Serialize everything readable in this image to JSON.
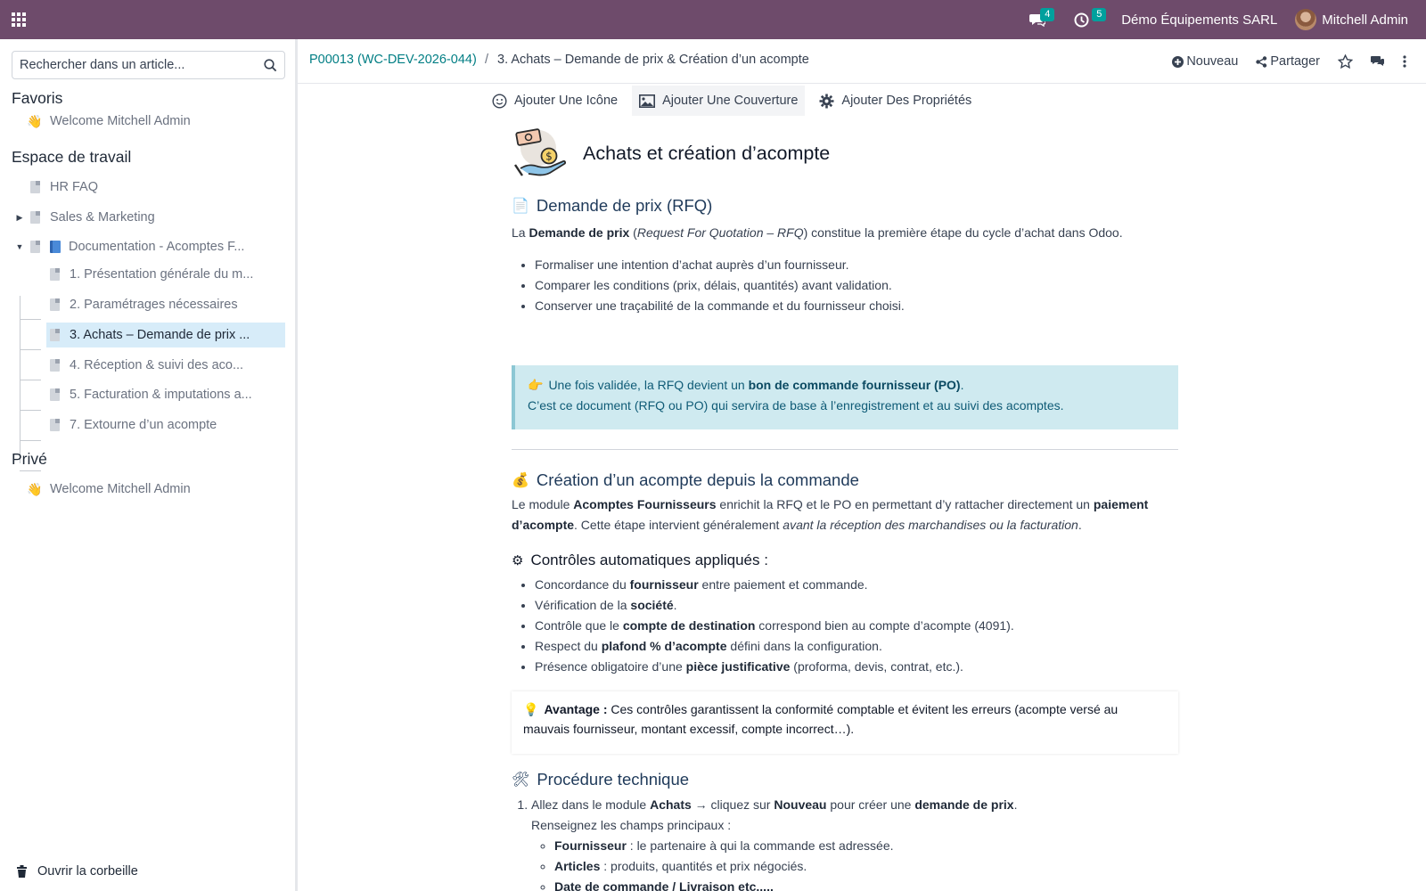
{
  "topbar": {
    "messages_count": "4",
    "activities_count": "5",
    "company": "Démo Équipements SARL",
    "user": "Mitchell Admin"
  },
  "sidebar": {
    "search_placeholder": "Rechercher dans un article...",
    "favorites_title": "Favoris",
    "favorites": [
      {
        "emoji": "👋",
        "label": "Welcome Mitchell Admin"
      }
    ],
    "workspace_title": "Espace de travail",
    "workspace": [
      {
        "label": "HR FAQ"
      },
      {
        "label": "Sales & Marketing"
      },
      {
        "label": "Documentation - Acomptes F..."
      }
    ],
    "children": [
      "1. Présentation générale du m...",
      "2. Paramétrages nécessaires",
      "3. Achats – Demande de prix ...",
      "4. Réception & suivi des aco...",
      "5. Facturation & imputations a...",
      "7. Extourne d’un acompte"
    ],
    "private_title": "Privé",
    "private": [
      {
        "emoji": "👋",
        "label": "Welcome Mitchell Admin"
      }
    ],
    "trash_label": "Ouvrir la corbeille"
  },
  "header": {
    "breadcrumb_parent": "P00013 (WC-DEV-2026-044)",
    "breadcrumb_sep": "/",
    "breadcrumb_current": "3. Achats – Demande de prix & Création d’un acompte",
    "new_label": "Nouveau",
    "share_label": "Partager"
  },
  "page_actions": {
    "add_icon": "Ajouter Une Icône",
    "add_cover": "Ajouter Une Couverture",
    "add_properties": "Ajouter Des Propriétés"
  },
  "article": {
    "title": "Achats et création d’acompte",
    "s1": {
      "emoji": "📄",
      "heading": "Demande de prix (RFQ)",
      "intro_pre": "La ",
      "intro_b": "Demande de prix",
      "intro_mid": " (",
      "intro_i": "Request For Quotation – RFQ",
      "intro_post": ") constitue la première étape du cycle d’achat dans Odoo.",
      "bullets": [
        "Formaliser une intention d’achat auprès d’un fournisseur.",
        "Comparer les conditions (prix, délais, quantités) avant validation.",
        "Conserver une traçabilité de la commande et du fournisseur choisi."
      ],
      "callout_emoji": "👉",
      "callout_l1_pre": "Une fois validée, la RFQ devient un ",
      "callout_l1_b": "bon de commande fournisseur (PO)",
      "callout_l1_post": ".",
      "callout_l2": "C’est ce document (RFQ ou PO) qui servira de base à l’enregistrement et au suivi des acomptes."
    },
    "s2": {
      "emoji": "💰",
      "heading": "Création d’un acompte depuis la commande",
      "p_pre": "Le module ",
      "p_b1": "Acomptes Fournisseurs",
      "p_mid": " enrichit la RFQ et le PO en permettant d’y rattacher directement un ",
      "p_b2": "paiement d’acompte",
      "p_mid2": ". Cette étape intervient généralement ",
      "p_i": "avant la réception des marchandises ou la facturation",
      "p_post": "."
    },
    "s3": {
      "emoji": "⚙",
      "heading": "Contrôles automatiques appliqués :",
      "bullets": [
        {
          "pre": "Concordance du ",
          "b": "fournisseur",
          "post": " entre paiement et commande."
        },
        {
          "pre": "Vérification de la ",
          "b": "société",
          "post": "."
        },
        {
          "pre": "Contrôle que le ",
          "b": "compte de destination",
          "post": " correspond bien au compte d’acompte (4091)."
        },
        {
          "pre": "Respect du ",
          "b": "plafond % d’acompte",
          "post": " défini dans la configuration."
        },
        {
          "pre": "Présence obligatoire d’une ",
          "b": "pièce justificative",
          "post": " (proforma, devis, contrat, etc.)."
        }
      ],
      "tip_emoji": "💡",
      "tip_b": "Avantage :",
      "tip_text": " Ces contrôles garantissent la conformité comptable et évitent les erreurs (acompte versé au mauvais fournisseur, montant excessif, compte incorrect…)."
    },
    "s4": {
      "emoji": "🛠",
      "heading": "Procédure technique",
      "step1_pre": "Allez dans le module ",
      "step1_b1": "Achats",
      "step1_mid": " → cliquez sur ",
      "step1_b2": "Nouveau",
      "step1_mid2": " pour créer une ",
      "step1_b3": "demande de prix",
      "step1_post": ".",
      "step1_line2": "Renseignez les champs principaux :",
      "fields": [
        {
          "b": "Fournisseur",
          "post": " : le partenaire à qui la commande est adressée."
        },
        {
          "b": "Articles",
          "post": " : produits, quantités et prix négociés."
        },
        {
          "b": "Date de commande / Livraison etc.....",
          "post": ""
        }
      ]
    }
  }
}
